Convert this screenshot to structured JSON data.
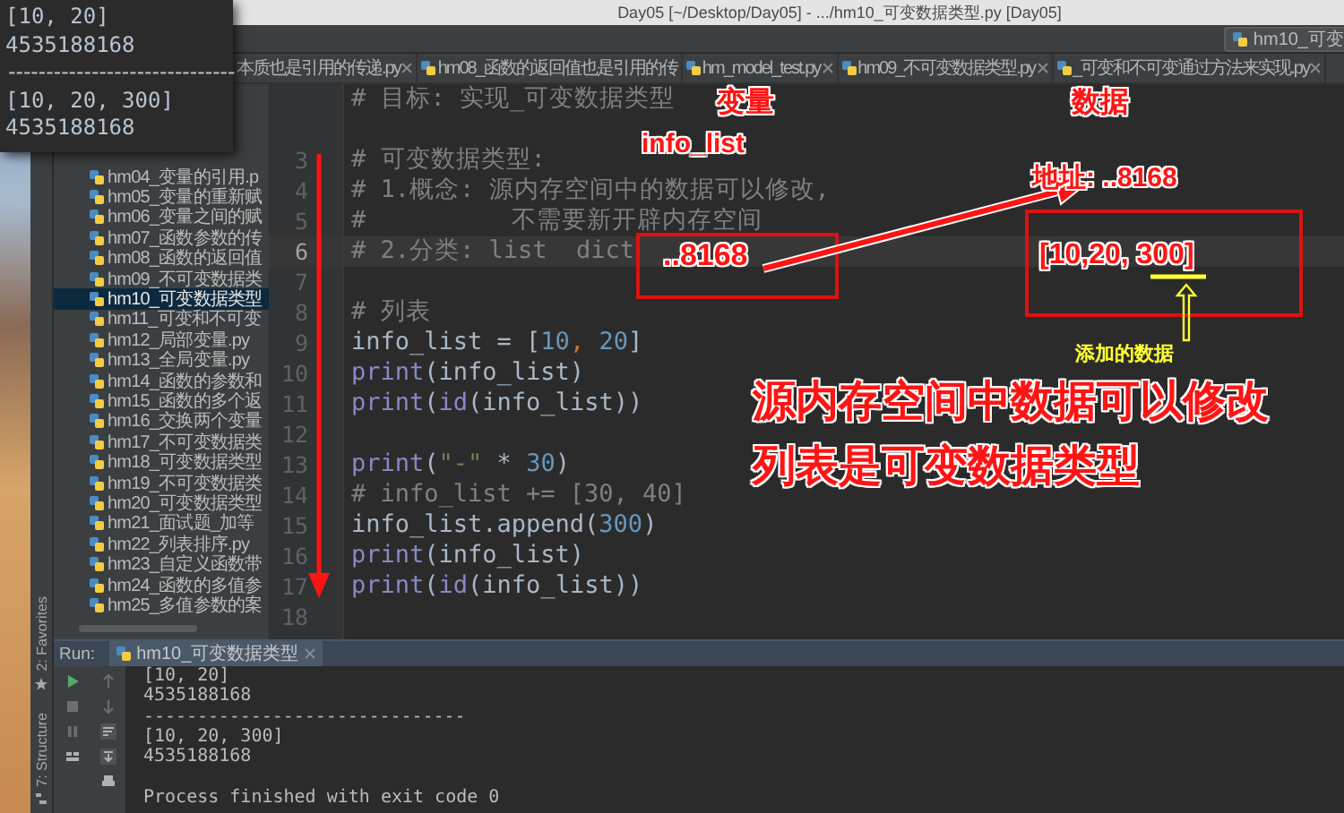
{
  "window": {
    "title": "Day05 [~/Desktop/Day05] - .../hm10_可变数据类型.py [Day05]"
  },
  "run_config": {
    "label": "hm10_可变"
  },
  "popup_output": {
    "lines": [
      "[10, 20]",
      "4535188168",
      "------------------------------",
      "[10, 20, 300]",
      "4535188168"
    ]
  },
  "tabs": [
    {
      "label": "本质也是引用的传递.py",
      "selected": false,
      "closable": true
    },
    {
      "label": "hm08_函数的返回值也是引用的传",
      "selected": false,
      "closable": false
    },
    {
      "label": "hm_model_test.py",
      "selected": false,
      "closable": true
    },
    {
      "label": "hm09_不可变数据类型.py",
      "selected": false,
      "closable": true
    },
    {
      "label": "_可变和不可变通过方法来实现.py",
      "selected": false,
      "closable": true
    }
  ],
  "project_tree": {
    "items": [
      {
        "label": "hm04_变量的引用.p",
        "selected": false
      },
      {
        "label": "hm05_变量的重新赋",
        "selected": false
      },
      {
        "label": "hm06_变量之间的赋",
        "selected": false
      },
      {
        "label": "hm07_函数参数的传",
        "selected": false
      },
      {
        "label": "hm08_函数的返回值",
        "selected": false
      },
      {
        "label": "hm09_不可变数据类",
        "selected": false
      },
      {
        "label": "hm10_可变数据类型",
        "selected": true
      },
      {
        "label": "hm11_可变和不可变",
        "selected": false
      },
      {
        "label": "hm12_局部变量.py",
        "selected": false
      },
      {
        "label": "hm13_全局变量.py",
        "selected": false
      },
      {
        "label": "hm14_函数的参数和",
        "selected": false
      },
      {
        "label": "hm15_函数的多个返",
        "selected": false
      },
      {
        "label": "hm16_交换两个变量",
        "selected": false
      },
      {
        "label": "hm17_不可变数据类",
        "selected": false
      },
      {
        "label": "hm18_可变数据类型",
        "selected": false
      },
      {
        "label": "hm19_不可变数据类",
        "selected": false
      },
      {
        "label": "hm20_可变数据类型",
        "selected": false
      },
      {
        "label": "hm21_面试题_加等",
        "selected": false
      },
      {
        "label": "hm22_列表排序.py",
        "selected": false
      },
      {
        "label": "hm23_自定义函数带",
        "selected": false
      },
      {
        "label": "hm24_函数的多值参",
        "selected": false
      },
      {
        "label": "hm25_多值参数的案",
        "selected": false
      }
    ]
  },
  "editor": {
    "lines": [
      {
        "current": false,
        "segments": [
          {
            "kind": "comment",
            "text": "# 目标: 实现_可变数据类型"
          }
        ]
      },
      {
        "current": false
      },
      {
        "number": "3",
        "current": false,
        "segments": [
          {
            "kind": "comment",
            "text": "# 可变数据类型:"
          }
        ]
      },
      {
        "number": "4",
        "current": false,
        "segments": [
          {
            "kind": "comment",
            "text": "# 1.概念: 源内存空间中的数据可以修改,"
          }
        ]
      },
      {
        "number": "5",
        "current": false,
        "segments": [
          {
            "kind": "comment",
            "text": "#          不需要新开辟内存空间"
          }
        ]
      },
      {
        "number": "6",
        "current": true,
        "segments": [
          {
            "kind": "comment",
            "text": "# 2.分类: list  dict"
          }
        ]
      },
      {
        "number": "7",
        "current": false
      },
      {
        "number": "8",
        "current": false,
        "segments": [
          {
            "kind": "comment",
            "text": "# 列表"
          }
        ]
      },
      {
        "number": "9",
        "current": false,
        "segments": [
          {
            "kind": "name",
            "text": "info_list = ["
          },
          {
            "kind": "number",
            "text": "10"
          },
          {
            "kind": "comma",
            "text": ", "
          },
          {
            "kind": "number",
            "text": "20"
          },
          {
            "kind": "name",
            "text": "]"
          }
        ]
      },
      {
        "number": "10",
        "current": false,
        "segments": [
          {
            "kind": "builtin",
            "text": "print"
          },
          {
            "kind": "name",
            "text": "(info_list)"
          }
        ]
      },
      {
        "number": "11",
        "current": false,
        "segments": [
          {
            "kind": "builtin",
            "text": "print"
          },
          {
            "kind": "name",
            "text": "("
          },
          {
            "kind": "builtin",
            "text": "id"
          },
          {
            "kind": "name",
            "text": "(info_list))"
          }
        ]
      },
      {
        "number": "12",
        "current": false
      },
      {
        "number": "13",
        "current": false,
        "segments": [
          {
            "kind": "builtin",
            "text": "print"
          },
          {
            "kind": "name",
            "text": "("
          },
          {
            "kind": "string",
            "text": "\"-\""
          },
          {
            "kind": "name",
            "text": " * "
          },
          {
            "kind": "number",
            "text": "30"
          },
          {
            "kind": "name",
            "text": ")"
          }
        ]
      },
      {
        "number": "14",
        "current": false,
        "segments": [
          {
            "kind": "comment",
            "text": "# info_list += [30, 40]"
          }
        ]
      },
      {
        "number": "15",
        "current": false,
        "segments": [
          {
            "kind": "name",
            "text": "info_list.append("
          },
          {
            "kind": "number",
            "text": "300"
          },
          {
            "kind": "name",
            "text": ")"
          }
        ]
      },
      {
        "number": "16",
        "current": false,
        "segments": [
          {
            "kind": "builtin",
            "text": "print"
          },
          {
            "kind": "name",
            "text": "(info_list)"
          }
        ]
      },
      {
        "number": "17",
        "current": false,
        "segments": [
          {
            "kind": "builtin",
            "text": "print"
          },
          {
            "kind": "name",
            "text": "("
          },
          {
            "kind": "builtin",
            "text": "id"
          },
          {
            "kind": "name",
            "text": "(info_list))"
          }
        ]
      },
      {
        "number": "18",
        "current": false
      }
    ]
  },
  "annotations": {
    "variable_label": "变量",
    "data_label": "数据",
    "name_label": "info_list",
    "name_address": "..8168",
    "address_label": "地址: ..8168",
    "value_label": "[10,20, 300]",
    "added_note": "添加的数据",
    "conclusion": [
      "源内存空间中数据可以修改",
      "列表是可变数据类型"
    ]
  },
  "tool_strip": {
    "items": [
      {
        "label": "2: Favorites"
      },
      {
        "label": "7: Structure"
      }
    ]
  },
  "run_panel": {
    "label": "Run:",
    "tab": {
      "label": "hm10_可变数据类型",
      "selected": true
    },
    "output": [
      "[10, 20]",
      "4535188168",
      "------------------------------",
      "[10, 20, 300]",
      "4535188168"
    ],
    "exit_message": "Process finished with exit code 0"
  }
}
